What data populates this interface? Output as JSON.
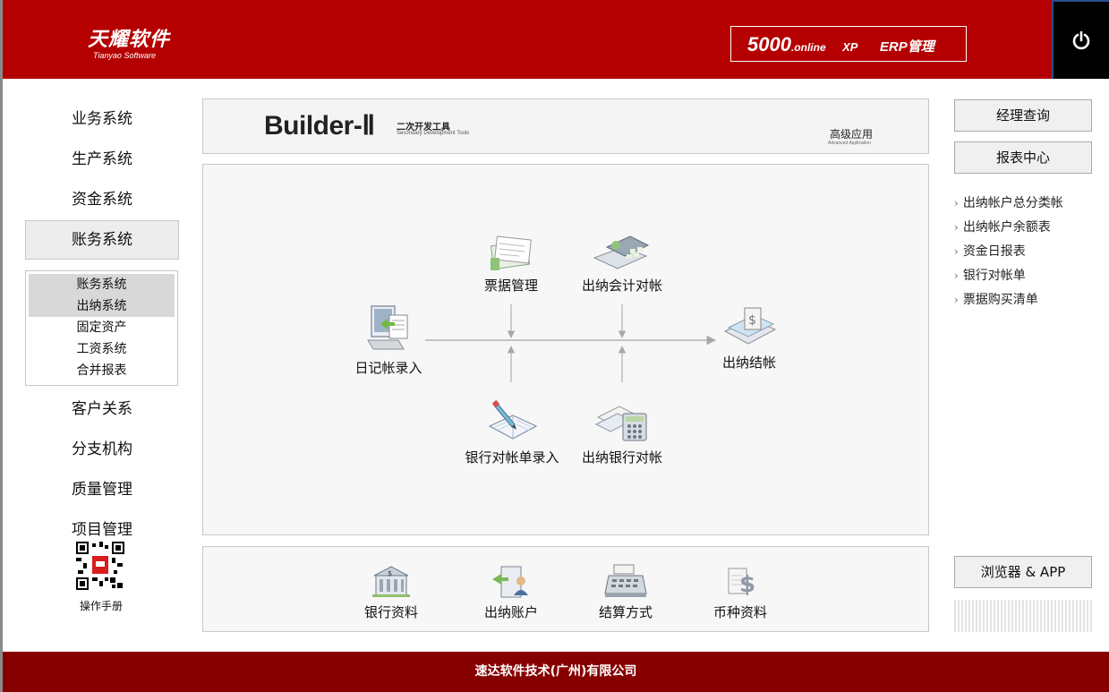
{
  "header": {
    "logo_cn": "天耀软件",
    "logo_en": "Tianyao Software",
    "brand_num": "5000",
    "brand_online": ".online",
    "brand_xp": "XP",
    "brand_erp": "ERP管理"
  },
  "nav": {
    "items": [
      "业务系统",
      "生产系统",
      "资金系统",
      "账务系统",
      "客户关系",
      "分支机构",
      "质量管理",
      "项目管理"
    ],
    "active_index": 3,
    "submenu": [
      "账务系统",
      "出纳系统",
      "固定资产",
      "工资系统",
      "合并报表"
    ],
    "submenu_selected": [
      "账务系统",
      "出纳系统"
    ],
    "manual_label": "操作手册"
  },
  "builder": {
    "title": "Builder-Ⅱ",
    "subtitle_cn": "二次开发工具",
    "subtitle_en": "Secondary Development Tools",
    "advanced_cn": "高级应用",
    "advanced_en": "Advanced Application"
  },
  "flow": {
    "diary_entry": "日记帐录入",
    "bill_management": "票据管理",
    "cashier_accounting_reconcile": "出纳会计对帐",
    "cashier_closing": "出纳结帐",
    "bank_statement_entry": "银行对帐单录入",
    "cashier_bank_reconcile": "出纳银行对帐"
  },
  "bottom": {
    "bank_info": "银行资料",
    "cashier_account": "出纳账户",
    "settlement_method": "结算方式",
    "currency_info": "币种资料"
  },
  "right": {
    "manager_query": "经理查询",
    "report_center": "报表中心",
    "links": [
      "出纳帐户总分类帐",
      "出纳帐户余额表",
      "资金日报表",
      "银行对帐单",
      "票据购买清单"
    ],
    "browser_app": "浏览器 & APP"
  },
  "footer": {
    "company": "速达软件技术(广州)有限公司"
  },
  "colors": {
    "header_red": "#b40000",
    "footer_red": "#870000",
    "power_bg": "#000000"
  }
}
